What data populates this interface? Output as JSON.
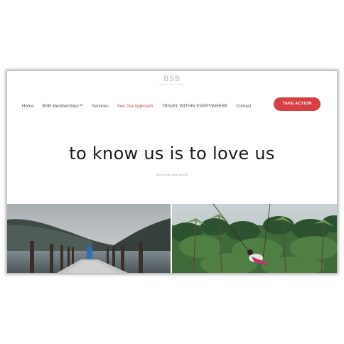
{
  "logo": {
    "main": "BSB",
    "sub": "bodhi.soul.body"
  },
  "nav": {
    "items": [
      {
        "label": "Home"
      },
      {
        "label": "BSB Memberships™"
      },
      {
        "label": "Services"
      },
      {
        "label": "See Our Approach",
        "active": true
      },
      {
        "label": "TRAVEL WITHIN EVERYWHERE"
      },
      {
        "label": "Contact"
      }
    ],
    "cta_label": "TAKE ACTION"
  },
  "hero": {
    "title": "to know us is to love us",
    "subtitle": "dive into our world"
  },
  "colors": {
    "accent": "#d74040",
    "active_nav": "#d34a44",
    "nav_text": "#4d5560"
  },
  "images": {
    "left": "person in blue rain jacket standing at end of wooden pier on misty mountain lake",
    "right": "woman on jungle swing above palm tree forest"
  }
}
